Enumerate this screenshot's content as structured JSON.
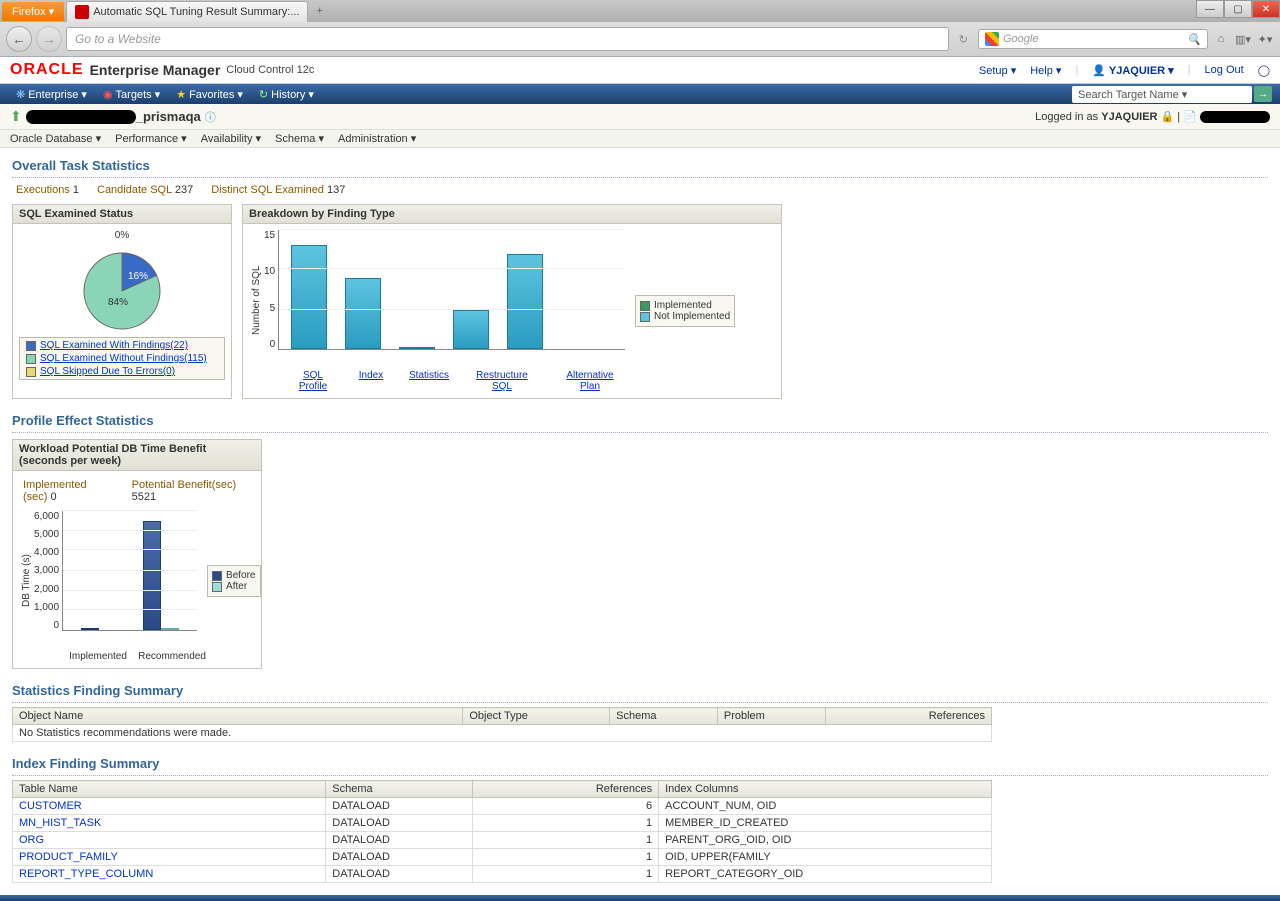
{
  "browser": {
    "firefox_label": "Firefox ▾",
    "tab_title": "Automatic SQL Tuning Result Summary:...",
    "url_placeholder": "Go to a Website",
    "search_placeholder": "Google"
  },
  "header": {
    "logo": "ORACLE",
    "product": "Enterprise Manager",
    "subtitle": "Cloud Control 12c",
    "links": {
      "setup": "Setup ▾",
      "help": "Help ▾",
      "logout": "Log Out"
    },
    "user": "YJAQUIER ▾"
  },
  "global_nav": {
    "items": [
      "Enterprise ▾",
      "Targets ▾",
      "Favorites ▾",
      "History ▾"
    ],
    "search_placeholder": "Search Target Name ▾"
  },
  "target": {
    "suffix": "_prismaqa",
    "logged_in_label": "Logged in as",
    "logged_in_user": "YJAQUIER"
  },
  "subnav": [
    "Oracle Database ▾",
    "Performance ▾",
    "Availability ▾",
    "Schema ▾",
    "Administration ▾"
  ],
  "overall": {
    "title": "Overall Task Statistics",
    "executions_label": "Executions",
    "executions": "1",
    "candidate_label": "Candidate SQL",
    "candidate": "237",
    "distinct_label": "Distinct SQL Examined",
    "distinct": "137"
  },
  "pie": {
    "title": "SQL Examined Status",
    "top_label": "0%",
    "slice_a": "16%",
    "slice_b": "84%",
    "legend": [
      {
        "label": "SQL Examined With Findings(22)",
        "color": "#3a6ac8"
      },
      {
        "label": "SQL Examined Without Findings(115)",
        "color": "#8ad4b8"
      },
      {
        "label": "SQL Skipped Due To Errors(0)",
        "color": "#e8d870"
      }
    ]
  },
  "bar": {
    "title": "Breakdown by Finding Type",
    "ylabel": "Number of SQL",
    "legend": [
      "Implemented",
      "Not Implemented"
    ]
  },
  "chart_data": [
    {
      "type": "pie",
      "title": "SQL Examined Status",
      "slices": [
        {
          "label": "SQL Examined With Findings",
          "value": 22,
          "pct": 16
        },
        {
          "label": "SQL Examined Without Findings",
          "value": 115,
          "pct": 84
        },
        {
          "label": "SQL Skipped Due To Errors",
          "value": 0,
          "pct": 0
        }
      ]
    },
    {
      "type": "bar",
      "title": "Breakdown by Finding Type",
      "ylabel": "Number of SQL",
      "ylim": [
        0,
        15
      ],
      "categories": [
        "SQL Profile",
        "Index",
        "Statistics",
        "Restructure SQL",
        "Alternative Plan"
      ],
      "series": [
        {
          "name": "Implemented",
          "values": [
            0,
            0,
            0,
            0,
            0
          ]
        },
        {
          "name": "Not Implemented",
          "values": [
            13,
            9,
            0,
            5,
            12
          ]
        }
      ]
    },
    {
      "type": "bar",
      "title": "Workload Potential DB Time Benefit (seconds per week)",
      "ylabel": "DB Time (s)",
      "ylim": [
        0,
        6000
      ],
      "categories": [
        "Implemented",
        "Recommended"
      ],
      "series": [
        {
          "name": "Before",
          "values": [
            0,
            5521
          ]
        },
        {
          "name": "After",
          "values": [
            0,
            50
          ]
        }
      ]
    }
  ],
  "profile": {
    "title": "Profile Effect Statistics",
    "subtitle": "Workload Potential DB Time Benefit (seconds per week)",
    "impl_label": "Implemented (sec)",
    "impl_val": "0",
    "pot_label": "Potential Benefit(sec)",
    "pot_val": "5521",
    "ylabel": "DB Time (s)",
    "x1": "Implemented",
    "x2": "Recommended",
    "legend": [
      "Before",
      "After"
    ]
  },
  "stats_finding": {
    "title": "Statistics Finding Summary",
    "cols": [
      "Object Name",
      "Object Type",
      "Schema",
      "Problem",
      "References"
    ],
    "empty": "No Statistics recommendations were made."
  },
  "index_finding": {
    "title": "Index Finding Summary",
    "cols": [
      "Table Name",
      "Schema",
      "References",
      "Index Columns"
    ],
    "rows": [
      {
        "table": "CUSTOMER",
        "schema": "DATALOAD",
        "refs": "6",
        "cols": "ACCOUNT_NUM, OID"
      },
      {
        "table": "MN_HIST_TASK",
        "schema": "DATALOAD",
        "refs": "1",
        "cols": "MEMBER_ID_CREATED"
      },
      {
        "table": "ORG",
        "schema": "DATALOAD",
        "refs": "1",
        "cols": "PARENT_ORG_OID, OID"
      },
      {
        "table": "PRODUCT_FAMILY",
        "schema": "DATALOAD",
        "refs": "1",
        "cols": "OID, UPPER(FAMILY"
      },
      {
        "table": "REPORT_TYPE_COLUMN",
        "schema": "DATALOAD",
        "refs": "1",
        "cols": "REPORT_CATEGORY_OID"
      }
    ]
  }
}
